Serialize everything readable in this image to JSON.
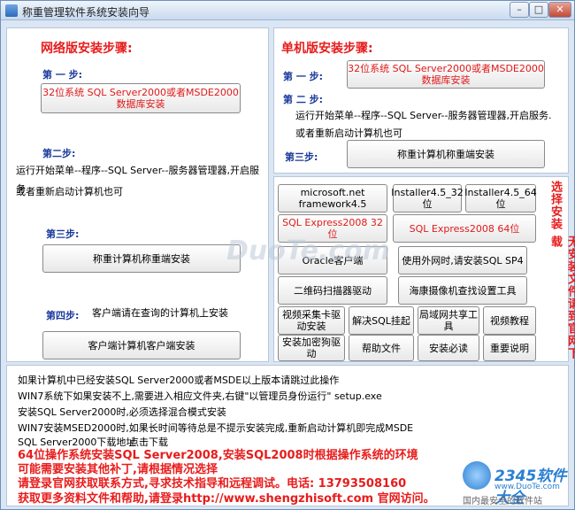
{
  "window": {
    "title": "称重管理软件系统安装向导",
    "min": "–",
    "max": "□",
    "close": "✕"
  },
  "network": {
    "heading": "网络版安装步骤:",
    "step1": "第 一 步:",
    "btn_sql2000": "32位系统 SQL Server2000或者MSDE2000数据库安装",
    "step2": "第二步:",
    "step2_line1": "运行开始菜单--程序--SQL Server--服务器管理器,开启服务",
    "step2_line2": "或者重新启动计算机也可",
    "step3": "第三步:",
    "btn_install": "称重计算机称重端安装",
    "step4": "第四步:",
    "step4_text": "客户端请在查询的计算机上安装",
    "btn_client": "客户端计算机客户端安装"
  },
  "single": {
    "heading": "单机版安装步骤:",
    "step1": "第 一 步:",
    "btn_sql2000": "32位系统 SQL Server2000或者MSDE2000数据库安装",
    "step2": "第 二 步:",
    "step2_line1": "运行开始菜单--程序--SQL Server--服务器管理器,开启服务.",
    "step2_line2": "或者重新启动计算机也可",
    "step3": "第三步:",
    "btn_install": "称重计算机称重端安装"
  },
  "grid": {
    "framework": "microsoft.net framework4.5",
    "installer32": "Installer4.5_32位",
    "installer64": "Installer4.5_64位",
    "express32": "SQL Express2008 32位",
    "express64": "SQL Express2008 64位",
    "oracle": "Oracle客户端",
    "sp4": "使用外网时,请安装SQL SP4",
    "qr": "二维码扫描器驱动",
    "camera": "海康摄像机查找设置工具",
    "video_card": "视频采集卡驱动安装",
    "sql_hang": "解决SQL挂起",
    "lan_share": "局域网共享工具",
    "video_tut": "视频教程",
    "dongle": "安装加密狗驱动",
    "help": "帮助文件",
    "must_read": "安装必读",
    "important": "重要说明"
  },
  "side": {
    "select": "选择安装",
    "missing": "无安装文件请到官网下载"
  },
  "info": {
    "l1": "如果计算机中已经安装SQL Server2000或者MSDE以上版本请跳过此操作",
    "l2": "WIN7系统下如果安装不上,需要进入相应文件夹,右键\"以管理员身份运行\" setup.exe",
    "l3": "安装SQL Server2000时,必须选择混合模式安装",
    "l4": "WIN7安装MSED2000时,如果长时间等待总是不提示安装完成,重新启动计算机即完成MSDE",
    "l5a": "SQL Server2000下载地址",
    "l5b": "点击下载",
    "r1": "64位操作系统安装SQL Server2008,安装SQL2008时根据操作系统的环境",
    "r2": "可能需要安装其他补丁,请根据情况选择",
    "r3": "请登录官网获取联系方式,寻求技术指导和远程调试。电话: 13793508160",
    "r4": "获取更多资料文件和帮助,请登录http://www.shengzhisoft.com 官网访问。"
  },
  "watermark": "DuoTe.com",
  "badge": {
    "n": "2345软件大全",
    "site": "www.DuoTe.com",
    "slogan": "国内最安全的软件站"
  },
  "colors": {
    "accent_red": "#e81c1c",
    "step_blue": "#1b3a9c",
    "bg": "#dbe6f4"
  }
}
